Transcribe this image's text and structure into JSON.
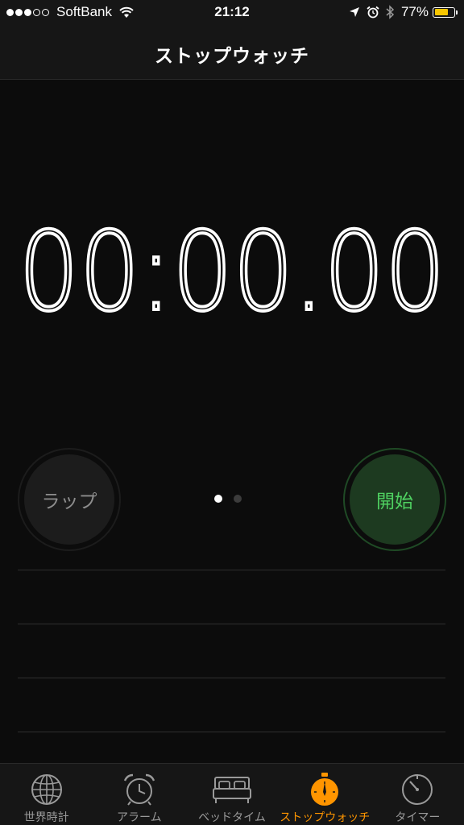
{
  "status_bar": {
    "carrier": "SoftBank",
    "time": "21:12",
    "battery_percent_label": "77%",
    "battery_level": 0.77,
    "signal_bars_on": 3,
    "signal_bars_total": 5
  },
  "nav": {
    "title": "ストップウォッチ"
  },
  "timer": {
    "display": "00:00.00"
  },
  "controls": {
    "lap_label": "ラップ",
    "start_label": "開始",
    "page_count": 2,
    "active_page": 0
  },
  "lap_list": {
    "rows": 4
  },
  "tab_bar": {
    "items": [
      {
        "label": "世界時計",
        "icon": "globe-icon",
        "active": false
      },
      {
        "label": "アラーム",
        "icon": "alarm-clock-icon",
        "active": false
      },
      {
        "label": "ベッドタイム",
        "icon": "bed-icon",
        "active": false
      },
      {
        "label": "ストップウォッチ",
        "icon": "stopwatch-icon",
        "active": true
      },
      {
        "label": "タイマー",
        "icon": "timer-icon",
        "active": false
      }
    ]
  },
  "colors": {
    "accent": "#ff9500",
    "start_text": "#4fd161",
    "start_bg": "#1d3a20",
    "lap_text": "#8d8d8d",
    "battery": "#f7c600",
    "background": "#0c0c0c"
  }
}
